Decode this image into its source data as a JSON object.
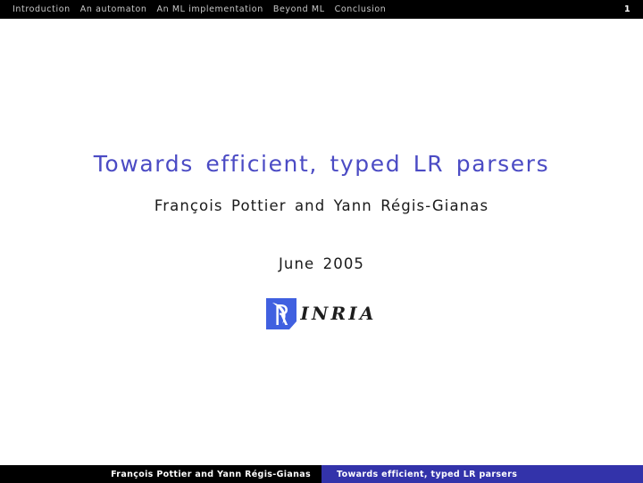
{
  "nav": {
    "items": [
      {
        "label": "Introduction"
      },
      {
        "label": "An automaton"
      },
      {
        "label": "An ML implementation"
      },
      {
        "label": "Beyond ML"
      },
      {
        "label": "Conclusion"
      }
    ],
    "page_number": "1",
    "background_color": "#000000",
    "text_color": "#c8c8c8"
  },
  "slide": {
    "title": "Towards efficient, typed LR parsers",
    "authors": "François Pottier and Yann Régis-Gianas",
    "date": "June 2005",
    "title_color": "#4b4bc4",
    "body_color": "#1a1a1a",
    "background_color": "#ffffff"
  },
  "logo": {
    "name": "inria-logo",
    "wordmark": "INRIA",
    "mark_color": "#4060e0",
    "wordmark_color": "#1d1d1d"
  },
  "footer": {
    "author_text": "François Pottier and Yann Régis-Gianas",
    "title_text": "Towards efficient, typed LR parsers",
    "author_background": "#000000",
    "title_background": "#3333aa",
    "text_color": "#ffffff"
  }
}
